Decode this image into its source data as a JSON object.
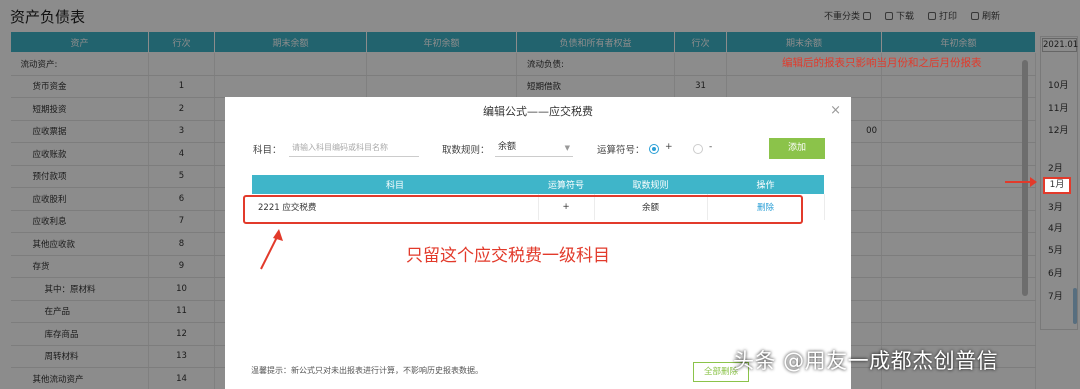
{
  "page": {
    "title": "资产负债表",
    "toolbar": [
      "不重分类",
      "下载",
      "打印",
      "刷新"
    ]
  },
  "table": {
    "headers": [
      "资产",
      "行次",
      "期末余额",
      "年初余额",
      "负债和所有者权益",
      "行次",
      "期末余额",
      "年初余额"
    ],
    "rows": [
      {
        "asset": "流动资产:",
        "line": "",
        "liab": "流动负债:",
        "lline": "",
        "indent": 0
      },
      {
        "asset": "货币资金",
        "line": "1",
        "liab": "短期借款",
        "lline": "31",
        "indent": 1
      },
      {
        "asset": "短期投资",
        "line": "2",
        "liab": "",
        "lline": "",
        "indent": 1
      },
      {
        "asset": "应收票据",
        "line": "3",
        "liab": "",
        "lline": "",
        "indent": 1
      },
      {
        "asset": "应收账款",
        "line": "4",
        "liab": "",
        "lline": "",
        "indent": 1
      },
      {
        "asset": "预付款项",
        "line": "5",
        "liab": "",
        "lline": "",
        "indent": 1
      },
      {
        "asset": "应收股利",
        "line": "6",
        "liab": "",
        "lline": "",
        "indent": 1
      },
      {
        "asset": "应收利息",
        "line": "7",
        "liab": "",
        "lline": "",
        "indent": 1
      },
      {
        "asset": "其他应收款",
        "line": "8",
        "liab": "",
        "lline": "",
        "indent": 1
      },
      {
        "asset": "存货",
        "line": "9",
        "liab": "",
        "lline": "",
        "indent": 1
      },
      {
        "asset": "其中：原材料",
        "line": "10",
        "liab": "",
        "lline": "",
        "indent": 2
      },
      {
        "asset": "在产品",
        "line": "11",
        "liab": "",
        "lline": "",
        "indent": 2
      },
      {
        "asset": "库存商品",
        "line": "12",
        "liab": "",
        "lline": "",
        "indent": 2
      },
      {
        "asset": "周转材料",
        "line": "13",
        "liab": "",
        "lline": "",
        "indent": 2
      },
      {
        "asset": "其他流动资产",
        "line": "14",
        "liab": "",
        "lline": "",
        "indent": 1
      }
    ],
    "partial_value": "00"
  },
  "side": {
    "year": "2021.01",
    "months": [
      "10月",
      "11月",
      "12月",
      "1月",
      "2月",
      "3月",
      "4月",
      "5月",
      "6月",
      "7月"
    ],
    "current_month": "1月",
    "note": "编辑后的报表只影响当月份和之后月份报表"
  },
  "modal": {
    "title": "编辑公式——应交税费",
    "subject_label": "科目：",
    "subject_placeholder": "请输入科目编码或科目名称",
    "rule_label": "取数规则：",
    "rule_value": "余额",
    "op_label": "运算符号：",
    "op_plus": "+",
    "op_minus": "-",
    "add_button": "添加",
    "columns": [
      "科目",
      "运算符号",
      "取数规则",
      "操作"
    ],
    "rows": [
      {
        "subject": "2221 应交税费",
        "op": "+",
        "rule": "余额",
        "action": "删除"
      }
    ],
    "annotation": "只留这个应交税费一级科目",
    "tip": "温馨提示：新公式只对未出报表进行计算，不影响历史报表数据。",
    "bottom_button": "全部删除"
  },
  "watermark": "头条 @用友一成都杰创普信",
  "colors": {
    "header": "#3fb5c9",
    "accent_red": "#e23a2b",
    "add_green": "#8bc34a",
    "link_blue": "#2a9fd6"
  }
}
